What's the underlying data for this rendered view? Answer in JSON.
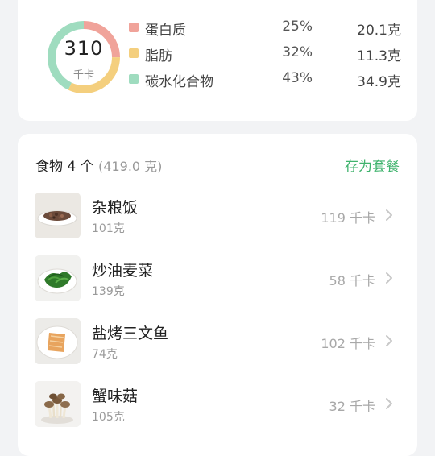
{
  "summary": {
    "kcal_value": "310",
    "kcal_unit": "千卡",
    "donut_colors": {
      "protein": "#f0a39a",
      "fat": "#f4cf7e",
      "carbs": "#9fdcbf"
    },
    "macros": [
      {
        "name": "蛋白质",
        "percent": "25%",
        "amount": "20.1克",
        "color": "#f0a39a",
        "fraction": 0.25
      },
      {
        "name": "脂肪",
        "percent": "32%",
        "amount": "11.3克",
        "color": "#f4cf7e",
        "fraction": 0.32
      },
      {
        "name": "碳水化合物",
        "percent": "43%",
        "amount": "34.9克",
        "color": "#9fdcbf",
        "fraction": 0.43
      }
    ]
  },
  "foods": {
    "title": "食物 4 个",
    "total_weight": "(419.0 克)",
    "save_set_label": "存为套餐",
    "accent_color": "#3fb36d",
    "items": [
      {
        "name": "杂粮饭",
        "weight": "101克",
        "kcal": "119 千卡",
        "icon": "rice-dish-icon"
      },
      {
        "name": "炒油麦菜",
        "weight": "139克",
        "kcal": "58 千卡",
        "icon": "greens-dish-icon"
      },
      {
        "name": "盐烤三文鱼",
        "weight": "74克",
        "kcal": "102 千卡",
        "icon": "salmon-dish-icon"
      },
      {
        "name": "蟹味菇",
        "weight": "105克",
        "kcal": "32 千卡",
        "icon": "mushroom-icon"
      }
    ]
  }
}
